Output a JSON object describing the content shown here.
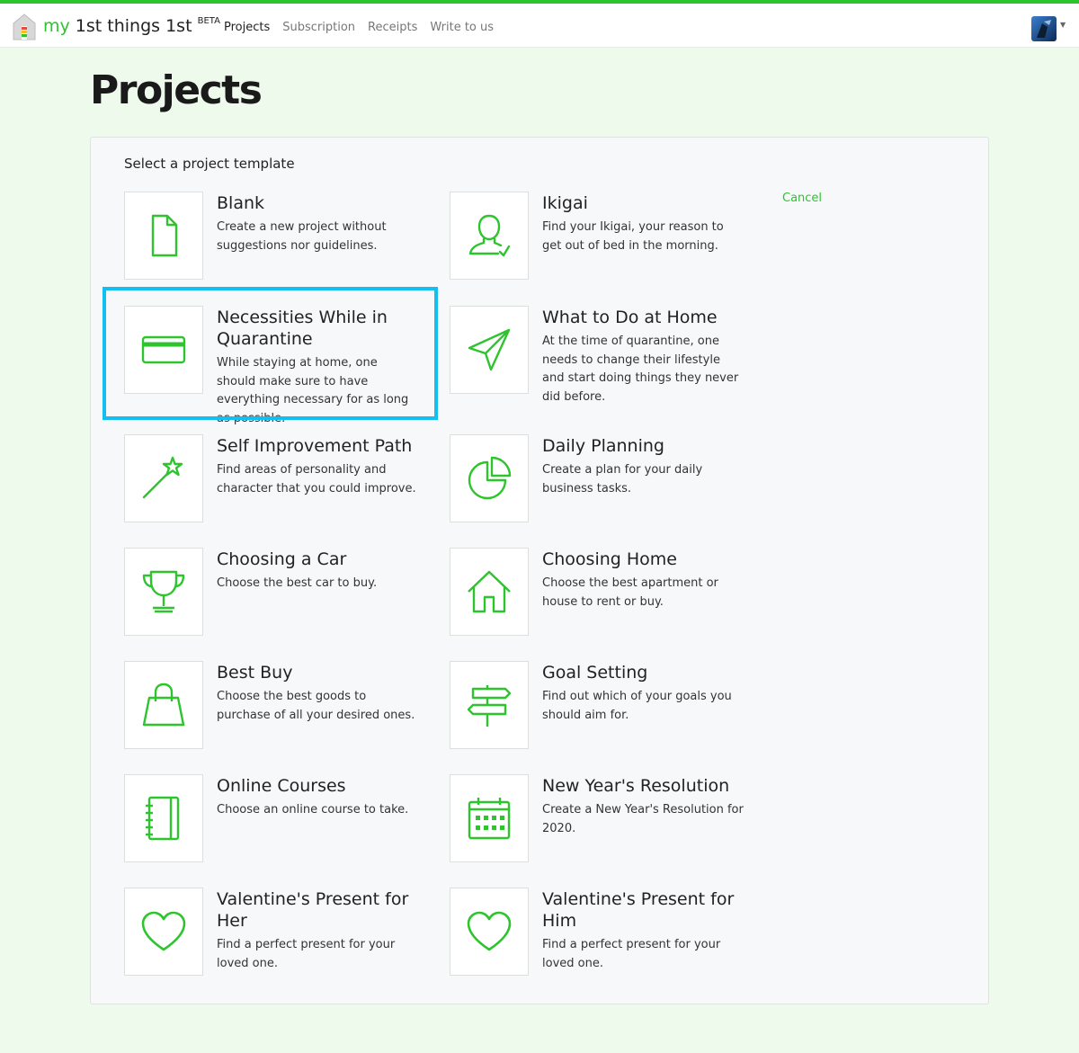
{
  "app": {
    "brand_my": "my",
    "brand_rest": " 1st things 1st",
    "brand_badge": "BETA",
    "accent_color": "#2ec42e"
  },
  "nav": {
    "items": [
      {
        "label": "Projects",
        "active": true
      },
      {
        "label": "Subscription",
        "active": false
      },
      {
        "label": "Receipts",
        "active": false
      },
      {
        "label": "Write to us",
        "active": false
      }
    ]
  },
  "user_menu": {
    "caret": "▼"
  },
  "page": {
    "title": "Projects"
  },
  "panel": {
    "heading": "Select a project template",
    "cancel_label": "Cancel"
  },
  "templates": [
    {
      "title": "Blank",
      "desc": "Create a new project without suggestions nor guidelines.",
      "icon": "document-icon"
    },
    {
      "title": "Ikigai",
      "desc": "Find your Ikigai, your reason to get out of bed in the morning.",
      "icon": "user-check-icon"
    },
    {
      "title": "Necessities While in Quarantine",
      "desc": "While staying at home, one should make sure to have everything necessary for as long as possible.",
      "icon": "credit-card-icon",
      "selected": true
    },
    {
      "title": "What to Do at Home",
      "desc": "At the time of quarantine, one needs to change their lifestyle and start doing things they never did before.",
      "icon": "paper-plane-icon"
    },
    {
      "title": "Self Improvement Path",
      "desc": "Find areas of personality and character that you could improve.",
      "icon": "magic-wand-icon"
    },
    {
      "title": "Daily Planning",
      "desc": "Create a plan for your daily business tasks.",
      "icon": "pie-chart-icon"
    },
    {
      "title": "Choosing a Car",
      "desc": "Choose the best car to buy.",
      "icon": "trophy-icon"
    },
    {
      "title": "Choosing Home",
      "desc": "Choose the best apartment or house to rent or buy.",
      "icon": "home-icon"
    },
    {
      "title": "Best Buy",
      "desc": "Choose the best goods to purchase of all your desired ones.",
      "icon": "shopping-bag-icon"
    },
    {
      "title": "Goal Setting",
      "desc": "Find out which of your goals you should aim for.",
      "icon": "signpost-icon"
    },
    {
      "title": "Online Courses",
      "desc": "Choose an online course to take.",
      "icon": "notebook-icon"
    },
    {
      "title": "New Year's Resolution",
      "desc": "Create a New Year's Resolution for 2020.",
      "icon": "calendar-icon"
    },
    {
      "title": "Valentine's Present for Her",
      "desc": "Find a perfect present for your loved one.",
      "icon": "heart-icon"
    },
    {
      "title": "Valentine's Present for Him",
      "desc": "Find a perfect present for your loved one.",
      "icon": "heart-icon"
    }
  ]
}
